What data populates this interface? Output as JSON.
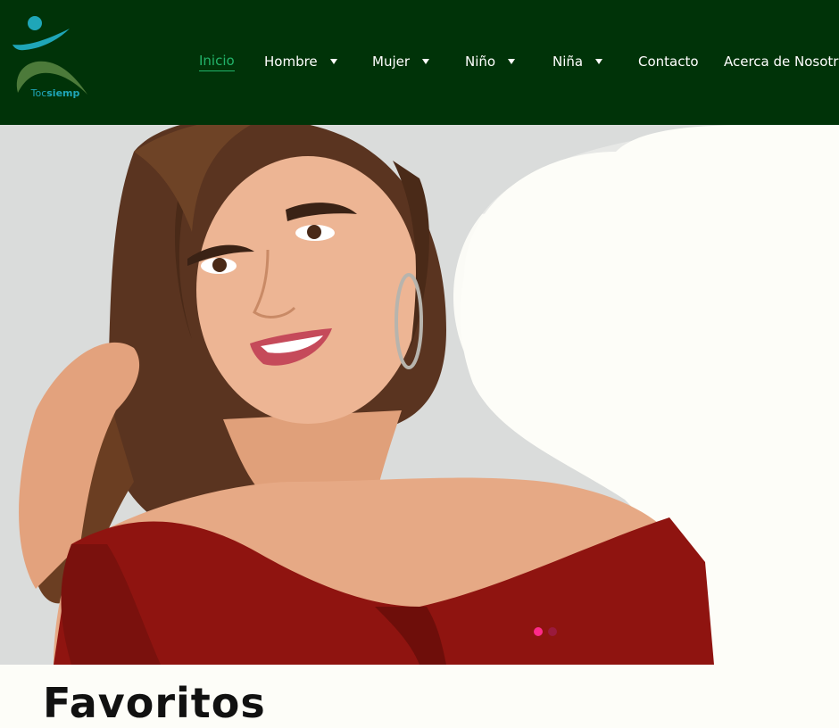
{
  "brand": {
    "logo_part1": "Toc",
    "logo_part2": "siemp"
  },
  "nav": {
    "items": [
      {
        "label": "Inicio",
        "active": true,
        "dropdown": false
      },
      {
        "label": "Hombre",
        "active": false,
        "dropdown": true
      },
      {
        "label": "Mujer",
        "active": false,
        "dropdown": true
      },
      {
        "label": "Niño",
        "active": false,
        "dropdown": true
      },
      {
        "label": "Niña",
        "active": false,
        "dropdown": true
      },
      {
        "label": "Contacto",
        "active": false,
        "dropdown": false
      },
      {
        "label": "Acerca de Nosotros",
        "active": false,
        "dropdown": false
      }
    ]
  },
  "hero": {
    "slides_total": 2,
    "active_slide": 1
  },
  "favorites": {
    "title": "Favoritos"
  },
  "colors": {
    "header_bg": "#003308",
    "active_link": "#22b36a",
    "logo_teal": "#1fa6b8",
    "dot_active": "#ff2a8a",
    "dot_inactive": "#9a1a3c",
    "dress": "#8f1410"
  },
  "icons": {
    "caret": "caret-down-icon",
    "logo": "tocsiemp-logo-icon"
  }
}
